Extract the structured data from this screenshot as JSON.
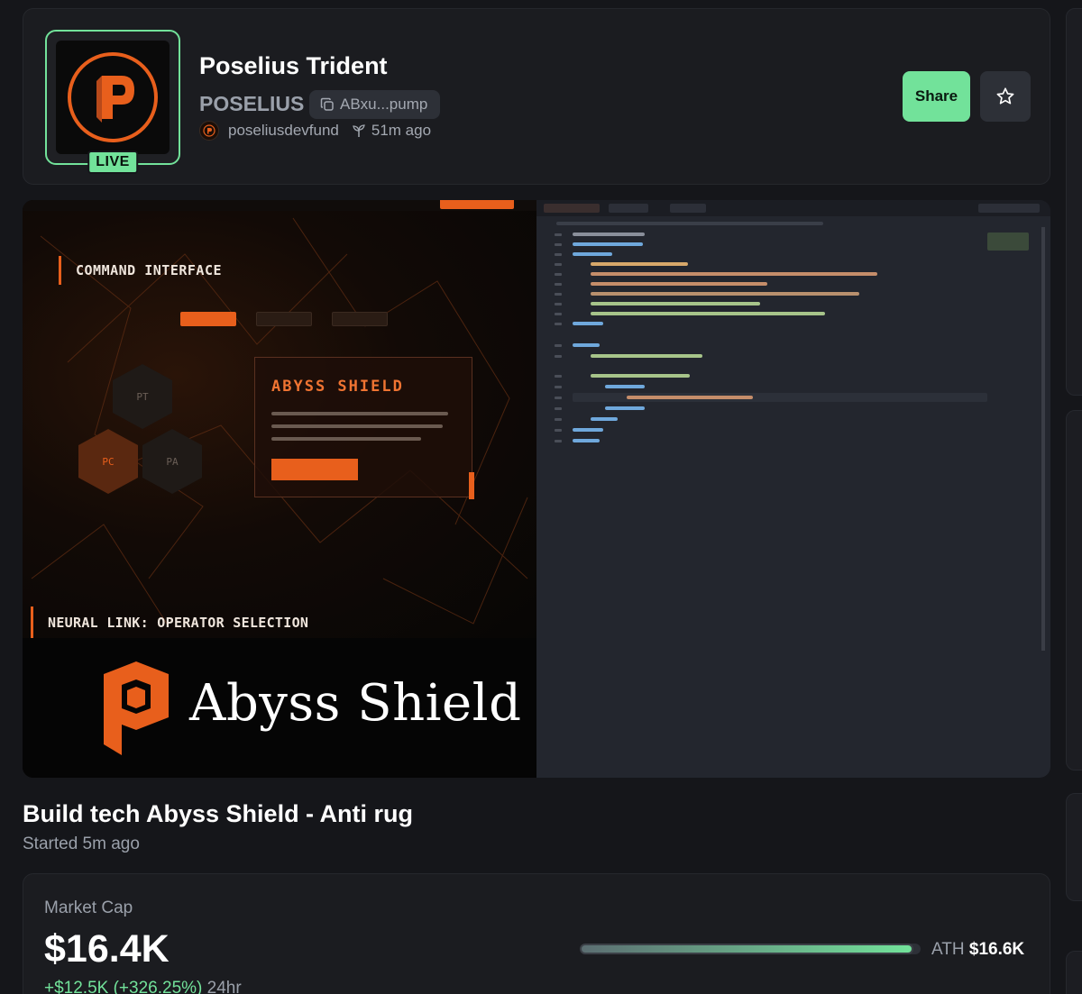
{
  "token": {
    "name": "Poselius Trident",
    "ticker": "POSELIUS",
    "address_short": "ABxu...pump",
    "creator": "poseliusdevfund",
    "created_ago": "51m ago",
    "live_badge": "LIVE"
  },
  "actions": {
    "share_label": "Share",
    "favorite_icon": "star-icon"
  },
  "stream": {
    "title": "Build tech Abyss Shield - Anti rug",
    "started": "Started 5m ago",
    "preview": {
      "command_interface": "COMMAND INTERFACE",
      "abyss_shield_title": "ABYSS SHIELD",
      "hex_labels": [
        "PT",
        "PC",
        "PA"
      ],
      "neural_link": "NEURAL LINK: OPERATOR SELECTION",
      "brand_name": "Abyss Shield"
    }
  },
  "market": {
    "label": "Market Cap",
    "value": "$16.4K",
    "change": "+$12.5K (+326.25%)",
    "change_period": "24hr",
    "ath_label": "ATH",
    "ath_value": "$16.6K",
    "progress_percent": 98
  },
  "colors": {
    "accent_green": "#72e29a",
    "brand_orange": "#e85f1c",
    "background": "#15161a",
    "card": "#1b1c20"
  }
}
